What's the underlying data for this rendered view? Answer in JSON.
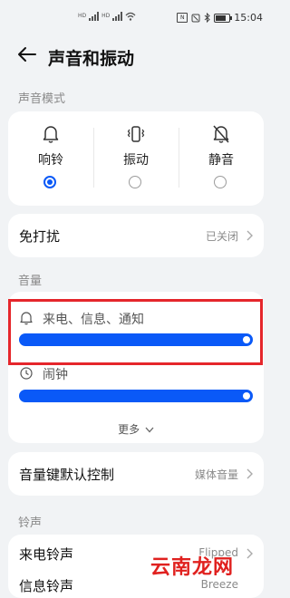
{
  "status_bar": {
    "time": "15:04",
    "hd_label": "HD",
    "nfc_label": "N"
  },
  "header": {
    "title": "声音和振动"
  },
  "sound_mode": {
    "section_label": "声音模式",
    "modes": [
      {
        "label": "响铃",
        "icon": "bell-icon",
        "selected": true
      },
      {
        "label": "振动",
        "icon": "vibrate-icon",
        "selected": false
      },
      {
        "label": "静音",
        "icon": "bell-off-icon",
        "selected": false
      }
    ]
  },
  "dnd": {
    "label": "免打扰",
    "value": "已关闭"
  },
  "volume": {
    "section_label": "音量",
    "items": [
      {
        "label": "来电、信息、通知",
        "icon": "bell-icon",
        "level": 1.0
      },
      {
        "label": "闹钟",
        "icon": "clock-icon",
        "level": 1.0
      }
    ],
    "more_label": "更多"
  },
  "volume_key": {
    "label": "音量键默认控制",
    "value": "媒体音量"
  },
  "ringtone": {
    "section_label": "铃声",
    "incoming": {
      "label": "来电铃声",
      "value": "Flipped"
    },
    "message": {
      "label": "信息铃声",
      "value": "Breeze"
    }
  },
  "watermark": "云南龙网",
  "colors": {
    "accent": "#0a59f7",
    "highlight": "#e5262b",
    "background": "#f1f3f5"
  }
}
